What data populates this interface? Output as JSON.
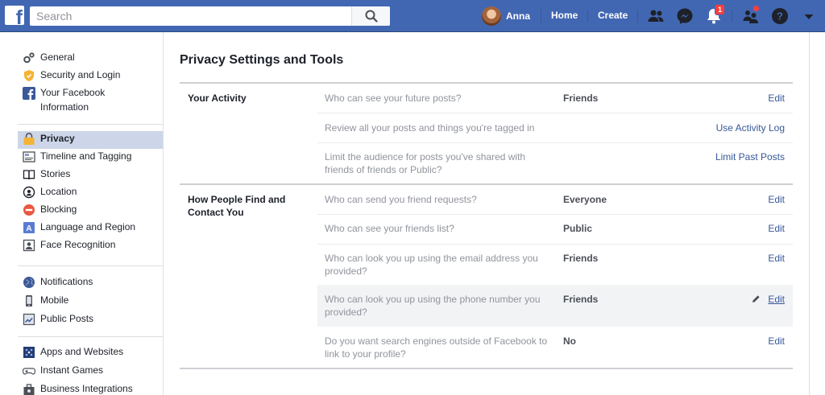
{
  "header": {
    "logo_letter": "f",
    "search_placeholder": "Search",
    "profile_name": "Anna",
    "home_label": "Home",
    "create_label": "Create",
    "notifications_count": "1",
    "brand_color": "#4267b2"
  },
  "sidebar": {
    "groups": [
      [
        {
          "label": "General",
          "icon": "gear-icon"
        },
        {
          "label": "Security and Login",
          "icon": "shield-icon"
        },
        {
          "label": "Your Facebook Information",
          "icon": "facebook-icon"
        }
      ],
      [
        {
          "label": "Privacy",
          "icon": "lock-icon",
          "selected": true
        },
        {
          "label": "Timeline and Tagging",
          "icon": "timeline-icon"
        },
        {
          "label": "Stories",
          "icon": "book-icon"
        },
        {
          "label": "Location",
          "icon": "location-icon"
        },
        {
          "label": "Blocking",
          "icon": "blocking-icon"
        },
        {
          "label": "Language and Region",
          "icon": "language-icon"
        },
        {
          "label": "Face Recognition",
          "icon": "face-recognition-icon"
        }
      ],
      [
        {
          "label": "Notifications",
          "icon": "globe-icon"
        },
        {
          "label": "Mobile",
          "icon": "mobile-icon"
        },
        {
          "label": "Public Posts",
          "icon": "public-posts-icon"
        }
      ],
      [
        {
          "label": "Apps and Websites",
          "icon": "apps-icon"
        },
        {
          "label": "Instant Games",
          "icon": "gamepad-icon"
        },
        {
          "label": "Business Integrations",
          "icon": "business-icon"
        }
      ]
    ]
  },
  "main": {
    "title": "Privacy Settings and Tools",
    "sections": [
      {
        "title": "Your Activity",
        "rows": [
          {
            "question": "Who can see your future posts?",
            "value": "Friends",
            "action": "Edit"
          },
          {
            "question": "Review all your posts and things you're tagged in",
            "value": "",
            "action": "Use Activity Log"
          },
          {
            "question": "Limit the audience for posts you've shared with friends of friends or Public?",
            "value": "",
            "action": "Limit Past Posts"
          }
        ]
      },
      {
        "title": "How People Find and Contact You",
        "rows": [
          {
            "question": "Who can send you friend requests?",
            "value": "Everyone",
            "action": "Edit"
          },
          {
            "question": "Who can see your friends list?",
            "value": "Public",
            "action": "Edit"
          },
          {
            "question": "Who can look you up using the email address you provided?",
            "value": "Friends",
            "action": "Edit"
          },
          {
            "question": "Who can look you up using the phone number you provided?",
            "value": "Friends",
            "action": "Edit",
            "hovered": true
          },
          {
            "question": "Do you want search engines outside of Facebook to link to your profile?",
            "value": "No",
            "action": "Edit"
          }
        ]
      }
    ]
  }
}
